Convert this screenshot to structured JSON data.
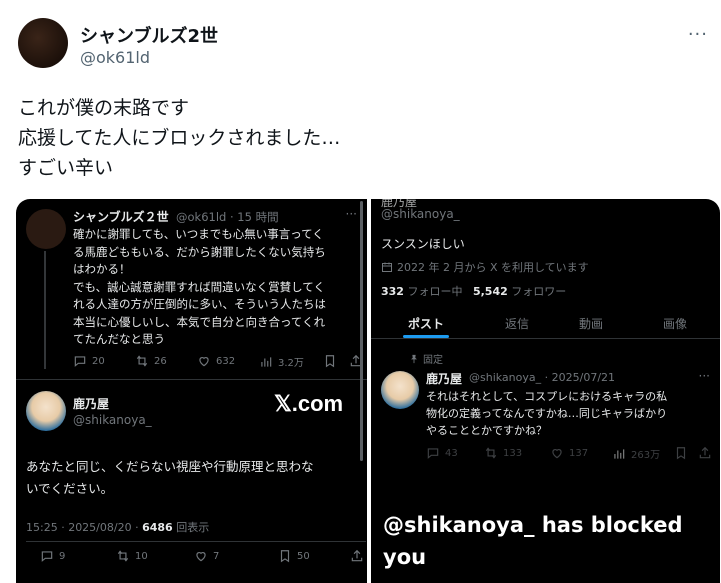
{
  "author": {
    "name": "シャンブルズ2世",
    "handle": "@ok61ld"
  },
  "post_lines": [
    "これが僕の末路です",
    "応援してた人にブロックされました…",
    "すごい辛い"
  ],
  "left_screenshot": {
    "reply": {
      "name": "シャンブルズ２世",
      "meta": "@ok61ld · 15 時間",
      "lines": [
        "確かに謝罪しても、いつまでも心無い事言ってく",
        "る馬鹿どももいる、だから謝罪したくない気持ち",
        "はわかる！",
        "でも、誠心誠意謝罪すれば間違いなく賞賛してく",
        "れる人達の方が圧倒的に多い、そういう人たちは",
        "本当に心優しいし、本気で自分と向き合ってくれ",
        "てたんだなと思う"
      ],
      "stats": {
        "replies": "20",
        "reposts": "26",
        "likes": "632",
        "views": "3.2万"
      }
    },
    "original": {
      "name": "鹿乃屋",
      "handle": "@shikanoya_",
      "watermark": "𝕏.com",
      "lines": [
        "あなたと同じ、くだらない視座や行動原理と思わな",
        "いでください。"
      ],
      "time": "15:25 · 2025/08/20 · ",
      "views_count": "6486",
      "views_label": " 回表示",
      "stats": {
        "replies": "9",
        "reposts": "10",
        "likes": "7",
        "bookmarks": "50"
      }
    }
  },
  "right_screenshot": {
    "top_cut_name": "鹿乃屋",
    "handle": "@shikanoya_",
    "bio": "スンスンほしい",
    "joined": "2022 年 2 月から X を利用しています",
    "following_count": "332",
    "following_label": " フォロー中",
    "followers_count": "5,542",
    "followers_label": " フォロワー",
    "tabs": [
      "ポスト",
      "返信",
      "動画",
      "画像"
    ],
    "pinned_label": "固定",
    "pinned_post": {
      "name": "鹿乃屋",
      "meta": "@shikanoya_ · 2025/07/21",
      "lines": [
        "それはそれとして、コスプレにおけるキャラの私",
        "物化の定義ってなんですかね…同じキャラばかり",
        "やることとかですかね？"
      ],
      "stats": {
        "replies": "43",
        "reposts": "133",
        "likes": "137",
        "views": "263万"
      }
    },
    "blocked_overlay": [
      "@shikanoya_ has blocked",
      "you"
    ]
  },
  "colors": {
    "accent": "#1d9bf0",
    "dark_bg": "#000000",
    "muted": "#71767b"
  }
}
